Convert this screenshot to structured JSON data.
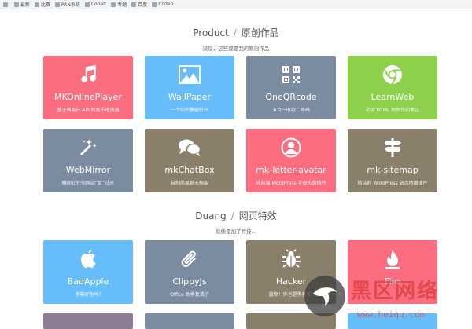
{
  "bookmarks": [
    "",
    "",
    "最新",
    "比赛",
    "PAN系统",
    "",
    "",
    "",
    "",
    "",
    "Cobalt",
    "专题",
    "",
    "",
    "",
    "",
    "百度",
    "",
    "Codeb",
    "",
    ""
  ],
  "sections": [
    {
      "title": "Product",
      "title_cn": "原创作品",
      "subtitle": "没错，这些都是我的原创作品",
      "cards": [
        {
          "name": "MKOnlinePlayer",
          "desc": "基于网易云 API 的音乐播放器",
          "icon": "music-note-icon",
          "color": "#fb6d7f"
        },
        {
          "name": "WallPaper",
          "desc": "一个归宗集壁纸站",
          "icon": "image-icon",
          "color": "#66bdfa"
        },
        {
          "name": "OneQRcode",
          "desc": "五合一收款二维码",
          "icon": "qr-code-icon",
          "color": "#7b8ca1"
        },
        {
          "name": "LearnWeb",
          "desc": "初学 HTML 时制作的笔记",
          "icon": "chrome-icon",
          "color": "#8cd04c"
        },
        {
          "name": "WebMirror",
          "desc": "瞬间让任何网站“反”过来",
          "icon": "magic-wand-icon",
          "color": "#7b8ca1"
        },
        {
          "name": "mkChatBox",
          "desc": "自制简易聊天框架",
          "icon": "chat-bubbles-icon",
          "color": "#8a7f6a"
        },
        {
          "name": "mk-letter-avatar",
          "desc": "纯前端 WordPress 字母头像插件",
          "icon": "avatar-icon",
          "color": "#fb6d7f"
        },
        {
          "name": "mk-sitemap",
          "desc": "简洁的 WordPress 站点地图插件",
          "icon": "signpost-icon",
          "color": "#8a7f6a"
        }
      ]
    },
    {
      "title": "Duang",
      "title_cn": "网页特效",
      "subtitle": "就像是加了特技...",
      "cards": [
        {
          "name": "BadApple",
          "desc": "字幕好色吗?",
          "icon": "apple-icon",
          "color": "#66bdfa"
        },
        {
          "name": "ClippyJs",
          "desc": "Office 助手复活了",
          "icon": "paperclip-icon",
          "color": "#7b8ca1"
        },
        {
          "name": "Hacker",
          "desc": "震惊！你也是黑客啦!",
          "icon": "bug-icon",
          "color": "#8a7f6a"
        },
        {
          "name": "Fire",
          "desc": "",
          "icon": "flame-icon",
          "color": "#fb6d7f"
        }
      ]
    }
  ],
  "watermark": {
    "text": "黑区网络",
    "url": "www.heiqu.com"
  }
}
